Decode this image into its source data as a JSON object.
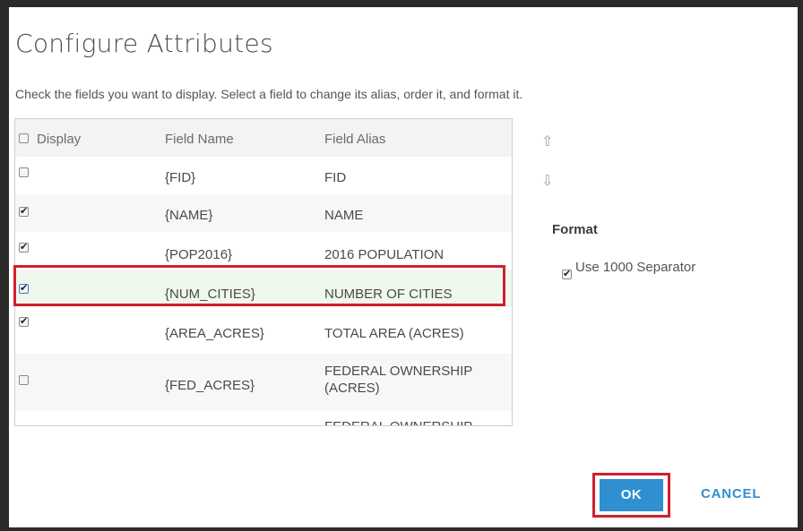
{
  "dialog": {
    "title": "Configure Attributes",
    "instructions": "Check the fields you want to display. Select a field to change its alias, order it, and format it."
  },
  "grid": {
    "columns": {
      "display": "Display",
      "field_name": "Field Name",
      "field_alias": "Field Alias"
    },
    "header_checkbox_checked": false,
    "rows": [
      {
        "checked": false,
        "field_name": "{FID}",
        "field_alias": "FID"
      },
      {
        "checked": true,
        "field_name": "{NAME}",
        "field_alias": "NAME"
      },
      {
        "checked": true,
        "field_name": "{POP2016}",
        "field_alias": "2016 POPULATION"
      },
      {
        "checked": true,
        "field_name": "{NUM_CITIES}",
        "field_alias": "NUMBER OF CITIES",
        "selected": true
      },
      {
        "checked": true,
        "field_name": "{AREA_ACRES}",
        "field_alias": "TOTAL AREA (ACRES)"
      },
      {
        "checked": false,
        "field_name": "{FED_ACRES}",
        "field_alias_line1": "FEDERAL OWNERSHIP",
        "field_alias_line2": "(ACRES)"
      },
      {
        "checked": false,
        "field_name": "",
        "field_alias": "FEDERAL OWNERSHIP"
      }
    ]
  },
  "side": {
    "move_up_icon": "arrow-up-icon",
    "move_down_icon": "arrow-down-icon",
    "format_label": "Format",
    "separator_label": "Use 1000 Separator",
    "separator_checked": true
  },
  "footer": {
    "ok_label": "OK",
    "cancel_label": "CANCEL"
  },
  "colors": {
    "accent": "#2f8fd0",
    "highlight_border": "#d0202e",
    "selected_row": "#eef8ec"
  }
}
